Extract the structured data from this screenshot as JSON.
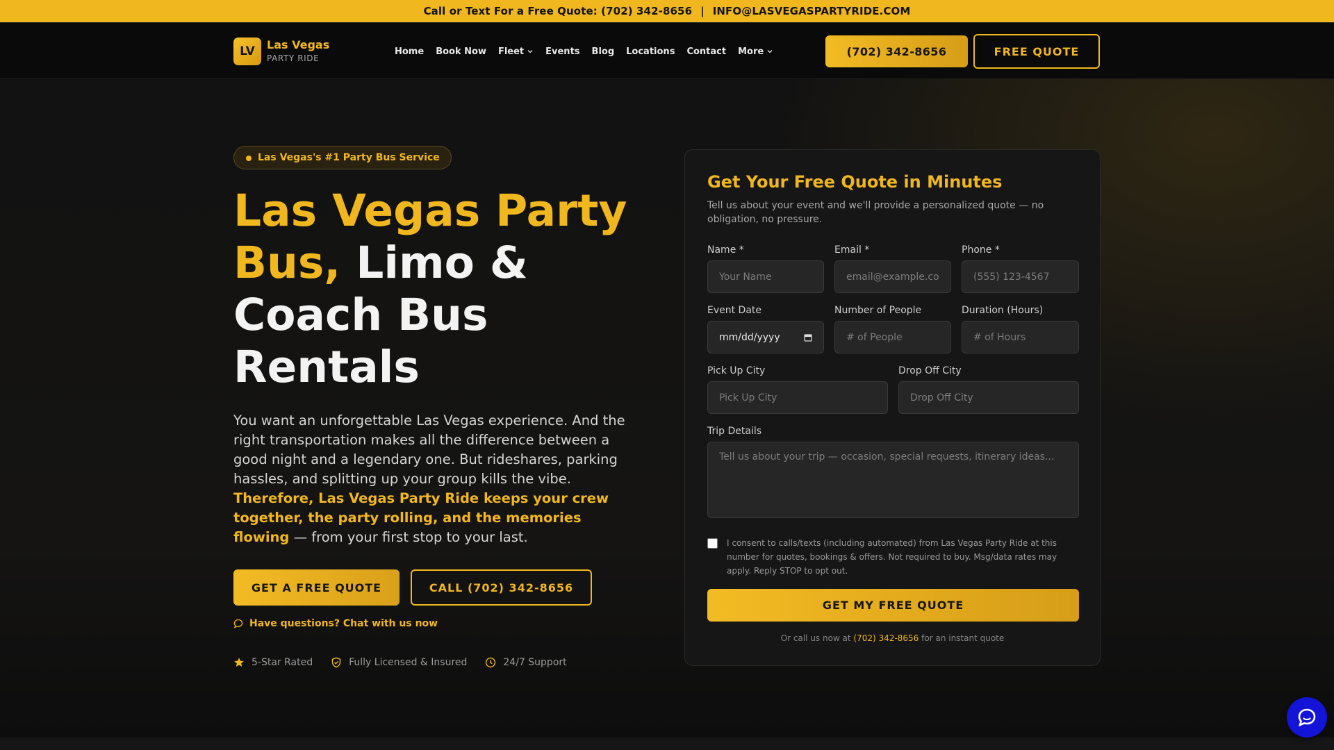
{
  "topbar": {
    "text": "Call or Text For a Free Quote: (702) 342-8656",
    "separator": "|",
    "email": "INFO@LASVEGASPARTYRIDE.COM"
  },
  "header": {
    "logo_badge": "LV",
    "logo_title": "Las Vegas",
    "logo_sub": "PARTY RIDE",
    "nav": [
      {
        "label": "Home"
      },
      {
        "label": "Book Now"
      },
      {
        "label": "Fleet",
        "dropdown": true
      },
      {
        "label": "Events"
      },
      {
        "label": "Blog"
      },
      {
        "label": "Locations"
      },
      {
        "label": "Contact"
      },
      {
        "label": "More",
        "dropdown": true
      }
    ],
    "phone_button": "(702) 342-8656",
    "quote_button": "FREE QUOTE"
  },
  "hero": {
    "pill": "Las Vegas's #1 Party Bus Service",
    "headline_gold": "Las Vegas Party Bus,",
    "headline_rest": "Limo & Coach Bus Rentals",
    "lead_plain": "You want an unforgettable Las Vegas experience. And the right transportation makes all the difference between a good night and a legendary one. But rideshares, parking hassles, and splitting up your group kills the vibe.",
    "lead_gold": "Therefore, Las Vegas Party Ride keeps your crew together, the party rolling, and the memories flowing",
    "lead_end": "— from your first stop to your last.",
    "cta_primary": "GET A FREE QUOTE",
    "cta_secondary": "CALL (702) 342-8656",
    "chat_link": "Have questions? Chat with us now",
    "trust": [
      {
        "label": "5-Star Rated",
        "icon": "star-icon"
      },
      {
        "label": "Fully Licensed & Insured",
        "icon": "shield-check-icon"
      },
      {
        "label": "24/7 Support",
        "icon": "clock-icon"
      }
    ]
  },
  "form": {
    "title": "Get Your Free Quote in Minutes",
    "subtitle": "Tell us about your event and we'll provide a personalized quote — no obligation, no pressure.",
    "name_label": "Name *",
    "name_placeholder": "Your Name",
    "email_label": "Email *",
    "email_placeholder": "email@example.com",
    "phone_label": "Phone *",
    "phone_placeholder": "(555) 123-4567",
    "date_label": "Event Date",
    "date_value": "mm/dd/yyyy",
    "people_label": "Number of People",
    "people_placeholder": "# of People",
    "duration_label": "Duration (Hours)",
    "duration_placeholder": "# of Hours",
    "pickup_label": "Pick Up City",
    "pickup_placeholder": "Pick Up City",
    "dropoff_label": "Drop Off City",
    "dropoff_placeholder": "Drop Off City",
    "details_label": "Trip Details",
    "details_placeholder": "Tell us about your trip — occasion, special requests, itinerary ideas...",
    "consent": "I consent to calls/texts (including automated) from Las Vegas Party Ride at this number for quotes, bookings & offers. Not required to buy. Msg/data rates may apply. Reply STOP to opt out.",
    "submit": "GET MY FREE QUOTE",
    "call_note_pre": "Or call us now at",
    "call_note_phone": "(702) 342-8656",
    "call_note_post": "for an instant quote"
  },
  "colors": {
    "accent": "#f1b71f",
    "background": "#0c0c0c",
    "card": "#161616",
    "chat": "#1414d8"
  }
}
